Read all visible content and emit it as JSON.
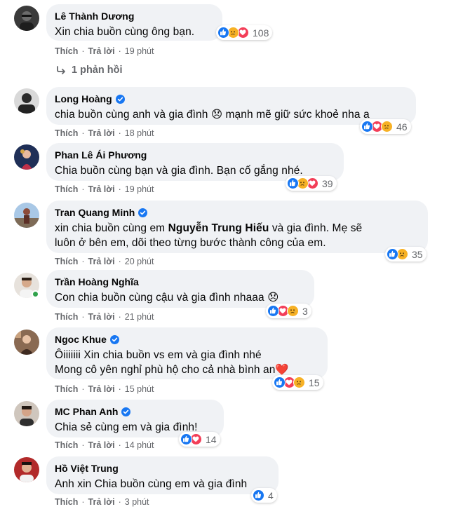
{
  "comments": [
    {
      "author": "Lê Thành Dương",
      "verified": false,
      "lines": [
        "Xin chia buồn cùng ông bạn."
      ],
      "reactions": [
        "like",
        "sad",
        "love"
      ],
      "reaction_count": "108",
      "like_label": "Thích",
      "reply_label": "Trả lời",
      "time": "19 phút",
      "replies_label": "1 phản hồi"
    },
    {
      "author": "Long Hoàng",
      "verified": true,
      "lines": [
        "chia buồn cùng anh và gia đình 😞 mạnh mẽ giữ sức khoẻ nha a"
      ],
      "reactions": [
        "like",
        "love",
        "sad"
      ],
      "reaction_count": "46",
      "like_label": "Thích",
      "reply_label": "Trả lời",
      "time": "18 phút"
    },
    {
      "author": "Phan Lê Ái Phương",
      "verified": false,
      "lines": [
        "Chia buồn cùng bạn và gia đình. Bạn cố gắng nhé."
      ],
      "reactions": [
        "like",
        "sad",
        "love"
      ],
      "reaction_count": "39",
      "like_label": "Thích",
      "reply_label": "Trả lời",
      "time": "19 phút"
    },
    {
      "author": "Tran Quang Minh",
      "verified": true,
      "line1_pre": "xin chia buồn cùng em ",
      "line1_bold": "Nguyễn Trung Hiếu",
      "line1_post": " và gia đình. Mẹ sẽ",
      "line2": "luôn ở bên em, dõi theo từng bước thành công của em.",
      "reactions": [
        "like",
        "sad"
      ],
      "reaction_count": "35",
      "like_label": "Thích",
      "reply_label": "Trả lời",
      "time": "20 phút"
    },
    {
      "author": "Trần Hoàng Nghĩa",
      "verified": false,
      "online": true,
      "lines": [
        "Con chia buồn cùng cậu và gia đình nhaaa 😞"
      ],
      "reactions": [
        "like",
        "love",
        "sad"
      ],
      "reaction_count": "3",
      "like_label": "Thích",
      "reply_label": "Trả lời",
      "time": "21 phút"
    },
    {
      "author": "Ngoc Khue",
      "verified": true,
      "lines": [
        "Ôiiiiiii Xin chia buồn vs em và gia đình nhé",
        "Mong cô yên nghỉ phù hộ cho cả nhà bình an❤️"
      ],
      "reactions": [
        "like",
        "love",
        "sad"
      ],
      "reaction_count": "15",
      "like_label": "Thích",
      "reply_label": "Trả lời",
      "time": "15 phút"
    },
    {
      "author": "MC Phan Anh",
      "verified": true,
      "lines": [
        "Chia sẻ cùng em và gia đình!"
      ],
      "reactions": [
        "like",
        "love"
      ],
      "reaction_count": "14",
      "like_label": "Thích",
      "reply_label": "Trả lời",
      "time": "14 phút"
    },
    {
      "author": "Hồ Việt Trung",
      "verified": false,
      "lines": [
        "Anh xin Chia buồn cùng em và gia đình"
      ],
      "reactions": [
        "like"
      ],
      "reaction_count": "4",
      "like_label": "Thích",
      "reply_label": "Trả lời",
      "time": "3 phút"
    }
  ],
  "colors": {
    "bubble": "#f0f2f5",
    "meta_text": "#65676b",
    "like_blue": "#1877f2",
    "love_red": "#f33e58",
    "sad_yellow": "#f7b125",
    "online_green": "#31a24c"
  }
}
